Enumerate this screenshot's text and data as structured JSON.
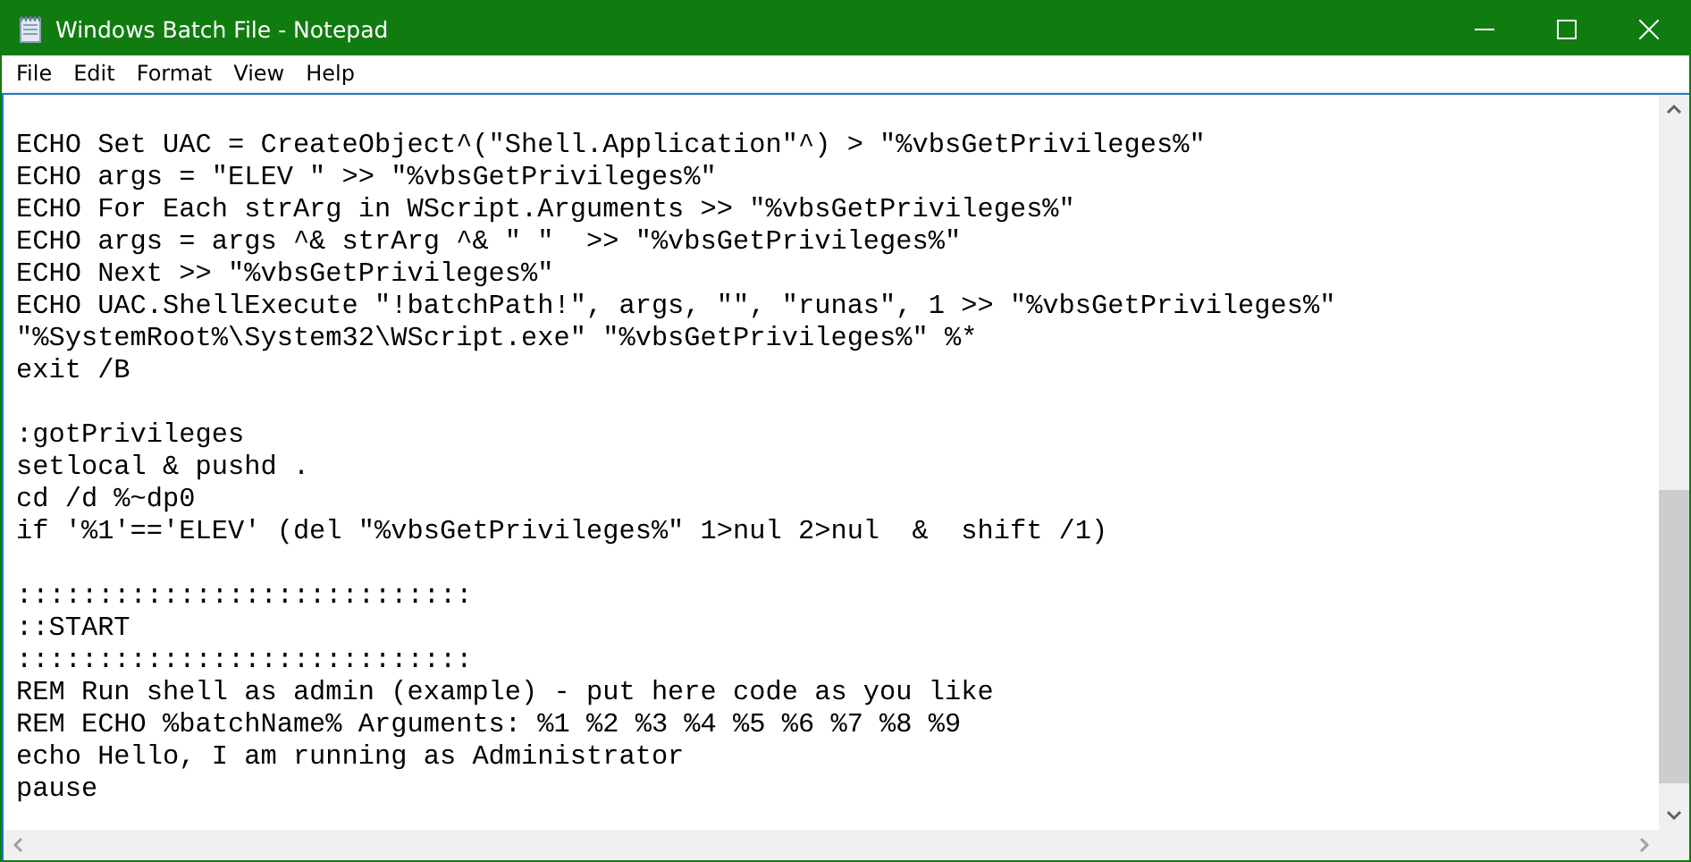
{
  "window": {
    "title": "Windows Batch File - Notepad"
  },
  "menu": [
    "File",
    "Edit",
    "Format",
    "View",
    "Help"
  ],
  "editor": {
    "blocks": [
      [
        "ECHO Set UAC = CreateObject^(\"Shell.Application\"^) > \"%vbsGetPrivileges%\"",
        "ECHO args = \"ELEV \" >> \"%vbsGetPrivileges%\"",
        "ECHO For Each strArg in WScript.Arguments >> \"%vbsGetPrivileges%\"",
        "ECHO args = args ^& strArg ^& \" \"  >> \"%vbsGetPrivileges%\"",
        "ECHO Next >> \"%vbsGetPrivileges%\"",
        "ECHO UAC.ShellExecute \"!batchPath!\", args, \"\", \"runas\", 1 >> \"%vbsGetPrivileges%\"",
        "\"%SystemRoot%\\System32\\WScript.exe\" \"%vbsGetPrivileges%\" %*",
        "exit /B"
      ],
      [
        ":gotPrivileges",
        "setlocal & pushd .",
        "cd /d %~dp0",
        "if '%1'=='ELEV' (del \"%vbsGetPrivileges%\" 1>nul 2>nul  &  shift /1)"
      ],
      [
        "::::::::::::::::::::::::::::",
        "::START",
        "::::::::::::::::::::::::::::",
        "REM Run shell as admin (example) - put here code as you like",
        "REM ECHO %batchName% Arguments: %1 %2 %3 %4 %5 %6 %7 %8 %9",
        "echo Hello, I am running as Administrator",
        "pause"
      ]
    ]
  }
}
